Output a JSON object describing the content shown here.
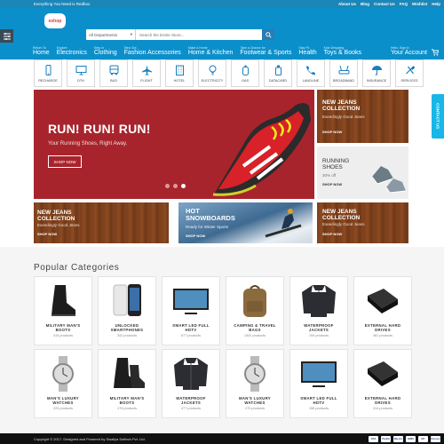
{
  "topbar": {
    "tagline": "Everything You Need is Redbox",
    "links": [
      "About Us",
      "Blog",
      "Contact Us",
      "FAQ",
      "Wishlist",
      "Help"
    ]
  },
  "header": {
    "logo_text": "eshop",
    "search": {
      "department": "All Departments",
      "placeholder": "Search the Entire Store..."
    },
    "nav": [
      {
        "small": "Return To",
        "label": "Home"
      },
      {
        "small": "Explore",
        "label": "Electronics"
      },
      {
        "small": "Step in",
        "label": "Clothing"
      },
      {
        "small": "Step Out",
        "label": "Fashion Accessories"
      },
      {
        "small": "Make A Home",
        "label": "Home & Kitchen"
      },
      {
        "small": "Take a Chance for",
        "label": "Footwear & Sports"
      },
      {
        "small": "Stay Fit",
        "label": "Health"
      },
      {
        "small": "Kids Wrapping",
        "label": "Toys & Books"
      }
    ],
    "account": {
      "small": "Hello, Sign in",
      "label": "Your Account"
    }
  },
  "services": [
    "RECHARGE",
    "DTH",
    "BUS",
    "FLIGHT",
    "HOTEL",
    "ELECTRICITY",
    "GAS",
    "DATACARD",
    "LANDLINE",
    "BROADBAND",
    "INSURANCE",
    "SERVICES"
  ],
  "hero": {
    "title": "RUN! RUN! RUN!",
    "subtitle": "Your Running Shoes, Right Away.",
    "button": "SHOP NOW"
  },
  "tiles": {
    "jeans_top": {
      "title": "NEW JEANS\nCOLLECTION",
      "sub": "Exeedingly Good Jeans",
      "link": "SHOP NOW"
    },
    "running": {
      "title": "RUNNING\nSHOES",
      "sub": "30% off",
      "link": "SHOP NOW"
    },
    "jeans_left": {
      "title": "NEW JEANS\nCOLLECTION",
      "sub": "Exeedingly Good Jeans",
      "link": "SHOP NOW"
    },
    "snow": {
      "title": "HOT\nSNOWBOARDS",
      "sub": "Ready for Winter Sports",
      "link": "SHOP NOW"
    },
    "jeans_right": {
      "title": "NEW JEANS\nCOLLECTION",
      "sub": "Exeedingly Good Jeans",
      "link": "SHOP NOW"
    }
  },
  "contact_tab": "CONTACT US",
  "popular": {
    "title": "Popular Categories",
    "items": [
      {
        "name": "MILITARY MAN'S BOOTS",
        "count": "415 products",
        "icon": "boot-icon"
      },
      {
        "name": "UNLOCKED SMARTPHONES",
        "count": "342 products",
        "icon": "smartphone-icon"
      },
      {
        "name": "SMART LED FULL HDTV",
        "count": "677 products",
        "icon": "tv-icon"
      },
      {
        "name": "CAMPING & TRAVEL BAGS",
        "count": "1342 products",
        "icon": "backpack-icon"
      },
      {
        "name": "WATERPROOF JACKETS",
        "count": "194 products",
        "icon": "jacket-icon"
      },
      {
        "name": "EXTERNAL HARD DRIVES",
        "count": "361 products",
        "icon": "hard-drive-icon"
      },
      {
        "name": "MAN'S LUXURY WATCHES",
        "count": "225 products",
        "icon": "watch-icon"
      },
      {
        "name": "MILITARY MAN'S BOOTS",
        "count": "176 products",
        "icon": "boot-icon"
      },
      {
        "name": "WATERPROOF JACKETS",
        "count": "477 products",
        "icon": "jacket-icon"
      },
      {
        "name": "MAN'S LUXURY WATCHES",
        "count": "270 products",
        "icon": "watch-icon"
      },
      {
        "name": "SMART LED FULL HDTV",
        "count": "156 products",
        "icon": "tv-icon"
      },
      {
        "name": "EXTERNAL HARD DRIVES",
        "count": "314 products",
        "icon": "hard-drive-icon"
      }
    ]
  },
  "footer": {
    "copyright": "Copyright © 2017. Designed and Powered by Swaliya Softech Pvt. Ltd.",
    "payments": [
      "VISA",
      "PayPal",
      "Maestro",
      "AMEX",
      "MC",
      "Discover"
    ]
  },
  "colors": {
    "header": "#0b8fca",
    "hero": "#a8242c",
    "contact": "#19b6e8"
  }
}
